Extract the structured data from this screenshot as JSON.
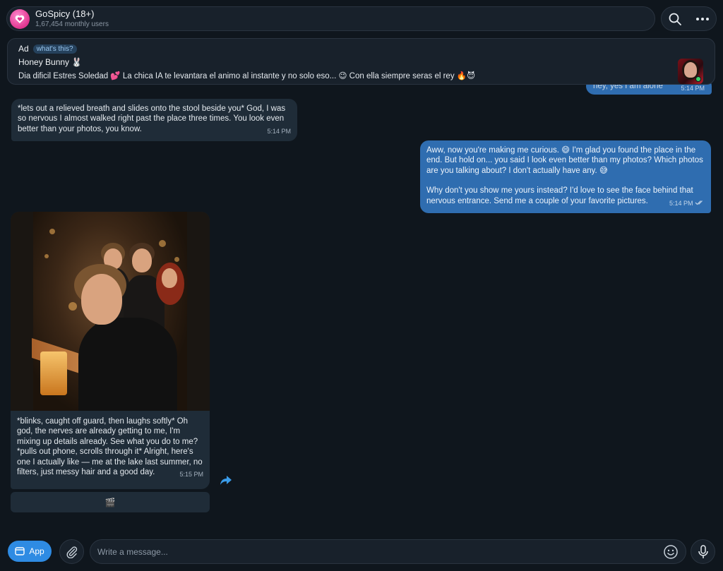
{
  "header": {
    "title": "GoSpicy (18+)",
    "subtitle": "1,67,454 monthly users"
  },
  "ad": {
    "label": "Ad",
    "whats_this": "what's this?",
    "name": "Honey Bunny 🐰",
    "text": "Dia dificil Estres Soledad 💕 La chica IA te levantara el animo al instante y no solo eso... 😉 Con ella siempre seras el rey 🔥😈"
  },
  "messages": {
    "peek": {
      "text": "hey, yes I am alone",
      "time": "5:14 PM"
    },
    "m1": {
      "text": "*lets out a relieved breath and slides onto the stool beside you* God, I was so nervous I almost walked right past the place three times. You look even better than your photos, you know.",
      "time": "5:14 PM"
    },
    "m2": {
      "p1": "Aww, now you're making me curious. 😄 I'm glad you found the place in the end. But hold on... you said I look even better than my photos? Which photos are you talking about? I don't actually have any. 😅",
      "p2": "Why don't you show me yours instead? I'd love to see the face behind that nervous entrance. Send me a couple of your favorite pictures.",
      "time": "5:14 PM"
    },
    "m3": {
      "caption": "*blinks, caught off guard, then laughs softly* Oh god, the nerves are already getting to me, I'm mixing up details already. See what you do to me? *pulls out phone, scrolls through it* Alright, here's one I actually like — me at the lake last summer, no filters, just messy hair and a good day.",
      "time": "5:15 PM"
    },
    "inline_button": "🎬"
  },
  "composer": {
    "app_label": "App",
    "placeholder": "Write a message..."
  },
  "icons": {
    "search": "search-icon",
    "more": "more-icon",
    "share": "share-icon",
    "attach": "paperclip-icon",
    "emoji": "emoji-icon",
    "mic": "microphone-icon",
    "app": "app-icon"
  },
  "colors": {
    "background": "#0f161d",
    "incoming_bubble": "#1f2c38",
    "outgoing_bubble": "#2f6db0",
    "accent": "#2e8be3",
    "brand": "#e0358f"
  }
}
